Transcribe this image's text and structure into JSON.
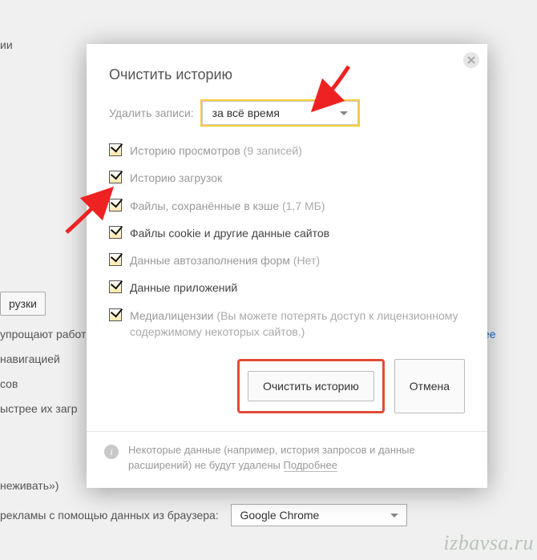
{
  "background": {
    "line1_frag": "ии",
    "btn_frag": "рузки",
    "line2_frag": "упрощают работ",
    "line3_frag": "навигацией",
    "line4_frag": "сов",
    "line5_frag": "ыстрее их загр",
    "line6_frag": "неживать»)",
    "line7_prefix": "рекламы с помощью данных из браузера:",
    "link_frag": "нее",
    "browser_select": "Google Chrome"
  },
  "modal": {
    "title": "Очистить историю",
    "period_label": "Удалить записи:",
    "period_value": "за всё время",
    "items": [
      {
        "label": "Историю просмотров",
        "hint": "(9 записей)"
      },
      {
        "label": "Историю загрузок",
        "hint": ""
      },
      {
        "label": "Файлы, сохранённые в кэше",
        "hint": "(1,7 МБ)"
      },
      {
        "label": "Файлы cookie и другие данные сайтов",
        "hint": "",
        "strong": true
      },
      {
        "label": "Данные автозаполнения форм",
        "hint": "(Нет)"
      },
      {
        "label": "Данные приложений",
        "hint": "",
        "strong": true
      },
      {
        "label": "Медиалицензии",
        "hint": "(Вы можете потерять доступ к лицензионному содержимому некоторых сайтов.)"
      }
    ],
    "primary_btn": "Очистить историю",
    "cancel_btn": "Отмена",
    "footer_text": "Некоторые данные (например, история запросов и данные расширений) не будут удалены",
    "footer_more": "Подробнее"
  },
  "watermark": "izbavsa.ru"
}
